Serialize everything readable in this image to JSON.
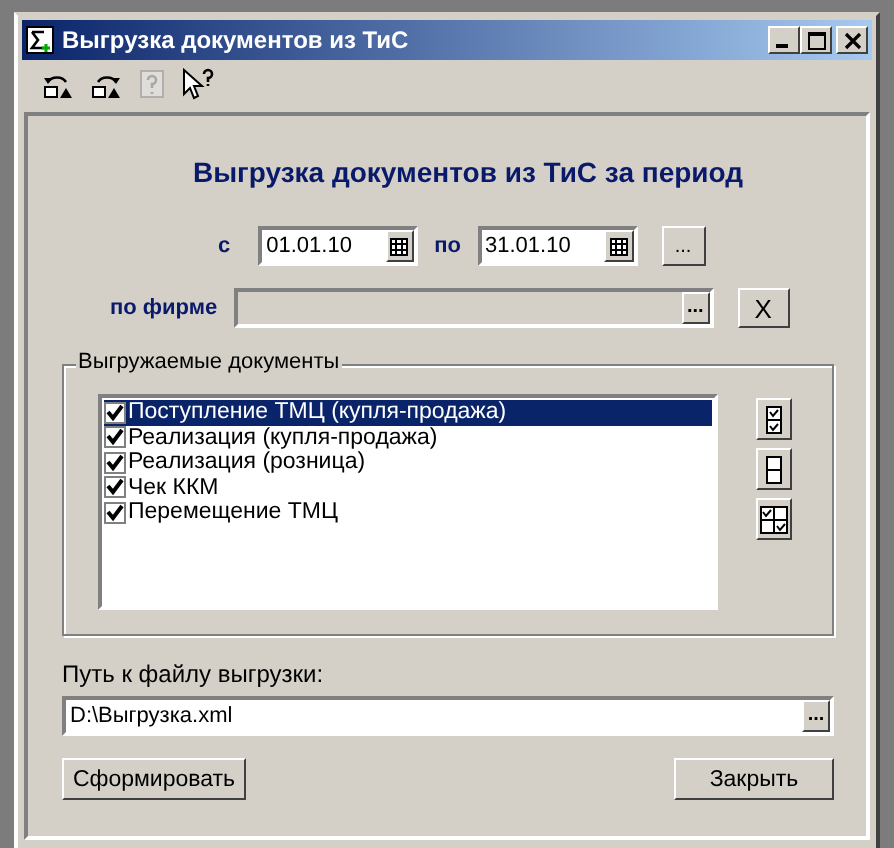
{
  "window": {
    "title": "Выгрузка документов из ТиС"
  },
  "toolbar": [
    {
      "kind": "undo"
    },
    {
      "kind": "redo"
    },
    {
      "kind": "help",
      "disabled": true
    },
    {
      "kind": "whatsthis"
    }
  ],
  "heading": "Выгрузка документов из ТиС за период",
  "period": {
    "from_label": "с",
    "from": "01.01.10",
    "to_label": "по",
    "to": "31.01.10",
    "more_button": "..."
  },
  "firm": {
    "label": "по фирме",
    "value_button": "...",
    "clear_button": "X"
  },
  "documents": {
    "title": "Выгружаемые документы",
    "items": [
      {
        "label": "Поступление ТМЦ (купля-продажа)",
        "checked": true,
        "selected": true
      },
      {
        "label": "Реализация (купля-продажа)",
        "checked": true,
        "selected": false
      },
      {
        "label": "Реализация (розница)",
        "checked": true,
        "selected": false
      },
      {
        "label": "Чек ККМ",
        "checked": true,
        "selected": false
      },
      {
        "label": "Перемещение ТМЦ",
        "checked": true,
        "selected": false
      }
    ],
    "side_buttons": [
      {
        "kind": "check-all"
      },
      {
        "kind": "uncheck-all"
      },
      {
        "kind": "invert"
      }
    ]
  },
  "path": {
    "label": "Путь к файлу выгрузки:",
    "value": "D:\\Выгрузка.xml",
    "browse_button": "..."
  },
  "buttons": [
    {
      "label": "Сформировать"
    },
    {
      "label": "Закрыть"
    }
  ]
}
